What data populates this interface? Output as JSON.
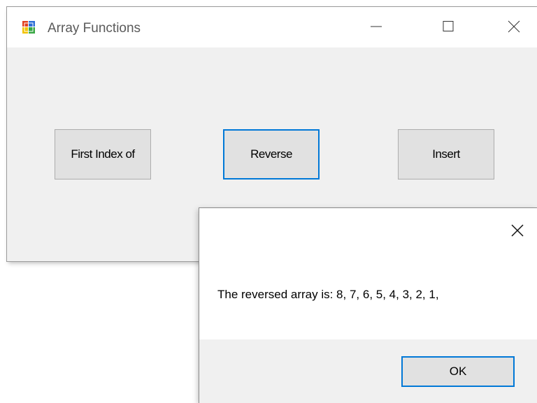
{
  "main_window": {
    "title": "Array Functions",
    "buttons": {
      "first_index_of": "First Index of",
      "reverse": "Reverse",
      "insert": "Insert"
    }
  },
  "message_box": {
    "text": "The reversed array is: 8, 7, 6, 5, 4, 3, 2, 1,",
    "ok_label": "OK"
  },
  "icons": {
    "app": "windows-forms-app-icon",
    "minimize": "minimize-icon",
    "maximize": "maximize-icon",
    "close": "close-icon"
  },
  "colors": {
    "focus_border": "#0078d7",
    "window_bg": "#f0f0f0",
    "button_bg": "#e1e1e1"
  }
}
